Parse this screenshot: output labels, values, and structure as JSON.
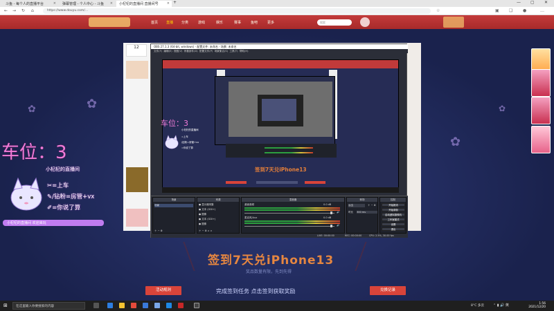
{
  "browser": {
    "tabs": [
      {
        "label": "斗鱼 - 每个人的直播平台"
      },
      {
        "label": "弹幕管理 - 个人中心 - 斗鱼"
      },
      {
        "label": "小杞杞的直播间 直播间号"
      }
    ],
    "url": "https://www.douyu.com/..."
  },
  "site": {
    "nav": [
      "首页",
      "直播",
      "分类",
      "游戏",
      "娱乐",
      "赛事",
      "鱼吧",
      "更多"
    ],
    "search_placeholder": "搜索"
  },
  "overlay": {
    "big_title": "车位：3",
    "small_title": "车位：3",
    "room_name": "小杞杞的直播间",
    "lines": [
      "=上车",
      "/钻粉=房管+vx",
      "=你说了算"
    ],
    "footer": "小杞杞的直播间 欢迎来玩"
  },
  "obs": {
    "title": "OBS 27.1.3 (64-bit, windows) - 配置文件: 未命名 - 场景: 未命名",
    "menu": [
      "文件(F)",
      "编辑(E)",
      "视图(V)",
      "停靠部件(D)",
      "配置文件(P)",
      "场景集合(S)",
      "工具(T)",
      "帮助(H)"
    ],
    "docks": {
      "scenes": {
        "title": "场景",
        "items": [
          "场景"
        ]
      },
      "sources": {
        "title": "来源",
        "items": [
          "显示器采集",
          "文本 (GDI+)",
          "图像",
          "文本 (GDI+)",
          "图像"
        ]
      },
      "mixer": {
        "title": "混音器",
        "tracks": [
          "桌面音频",
          "麦克风/Aux"
        ],
        "values": [
          "0.0 dB",
          "0.0 dB"
        ]
      },
      "transitions": {
        "title": "转场",
        "type": "淡出",
        "duration_label": "时长",
        "duration": "300 ms"
      },
      "controls": {
        "title": "控制",
        "buttons": [
          "开始推流",
          "开始录制",
          "启动虚拟摄像机",
          "工作室模式",
          "设置",
          "退出"
        ]
      }
    },
    "status": [
      "LIVE: 00:00:00",
      "REC: 00:00:00",
      "CPU: 2.5%, 30.00 fps"
    ]
  },
  "page": {
    "main_banner": "签到7天兑iPhone13",
    "sub_banner": "奖品数量有限，先到先得",
    "left_button": "活动规则",
    "right_button": "兑换记录",
    "hint": "完成签到任务 点击签到获取奖励",
    "pv_banner": "签到7天兑iPhone13"
  },
  "taskbar": {
    "search_placeholder": "在这里输入你要搜索的内容",
    "weather": "8°C 多云",
    "time": "1:56",
    "date": "2021/12/20"
  }
}
